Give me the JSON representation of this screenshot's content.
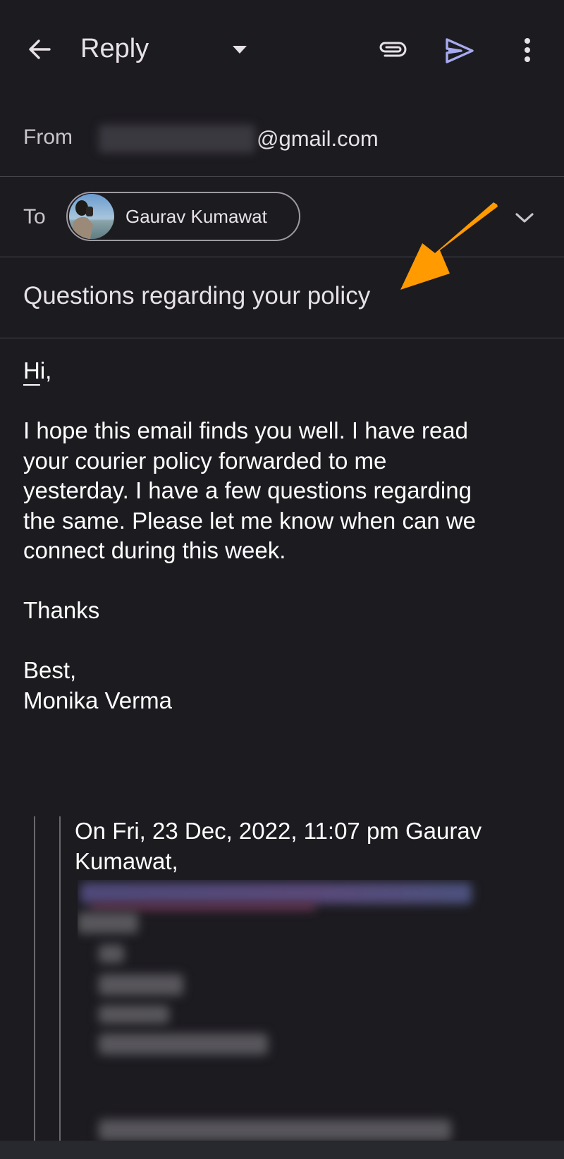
{
  "appbar": {
    "title": "Reply",
    "icons": {
      "back": "arrow-back-icon",
      "dropdown": "dropdown-triangle-icon",
      "attach": "paperclip-icon",
      "send": "send-icon",
      "more": "more-vert-icon"
    },
    "accent_color": "#a8aaf0"
  },
  "from": {
    "label": "From",
    "email_visible_suffix": "@gmail.com",
    "email_redacted": true
  },
  "to": {
    "label": "To",
    "recipient_name": "Gaurav Kumawat"
  },
  "subject": "Questions regarding your policy",
  "body": {
    "greeting_first": "H",
    "greeting_rest": "i,",
    "paragraph_lines": [
      "I hope this email finds you well. I have read",
      "your courier policy forwarded to me",
      "yesterday. I have a few questions regarding",
      "the same. Please let me know when can we",
      "connect during this week."
    ],
    "thanks": "Thanks",
    "signoff": "Best,",
    "signature": "Monika Verma"
  },
  "quoted": {
    "header_line1": "On Fri, 23 Dec, 2022, 11:07 pm Gaurav",
    "header_line2": "Kumawat,",
    "content_redacted": true
  },
  "annotation": {
    "arrow_color": "#ff9a00"
  }
}
